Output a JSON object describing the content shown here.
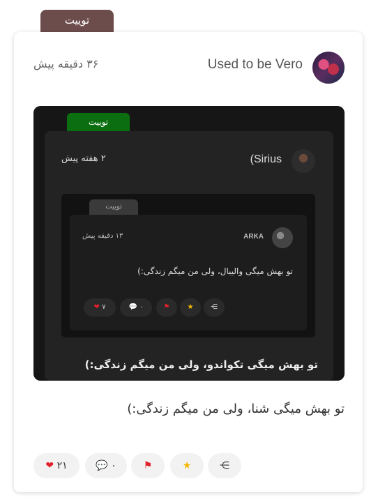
{
  "post": {
    "type_label": "توییت",
    "username": "Used to be Vero",
    "time": "۳۶ دقیقه پیش",
    "text": "تو بهش میگی شنا، ولی من میگم زندگی:)",
    "actions": {
      "likes": "۲۱",
      "comments": "۰"
    }
  },
  "embed": {
    "type_label": "توییت",
    "username": "(Sirius",
    "time": "۲ هفته پیش",
    "text": "تو بهش میگی تکواندو، ولی من میگم زندگی:)",
    "inner": {
      "type_label": "توییت",
      "username": "ARKA",
      "time": "۱۳ دقیقه پیش",
      "text": "تو بهش میگی والیبال، ولی من میگم زندگی:)",
      "actions": {
        "likes": "۷",
        "comments": "۰"
      }
    }
  },
  "icons": {
    "heart": "heart-icon",
    "comment": "comment-icon",
    "flag": "flag-icon",
    "star": "star-icon",
    "share": "share-icon"
  },
  "colors": {
    "tab": "#6d4c4c",
    "embed_tab": "#0b6e10",
    "heart": "#e0202a",
    "star": "#f5b800"
  }
}
